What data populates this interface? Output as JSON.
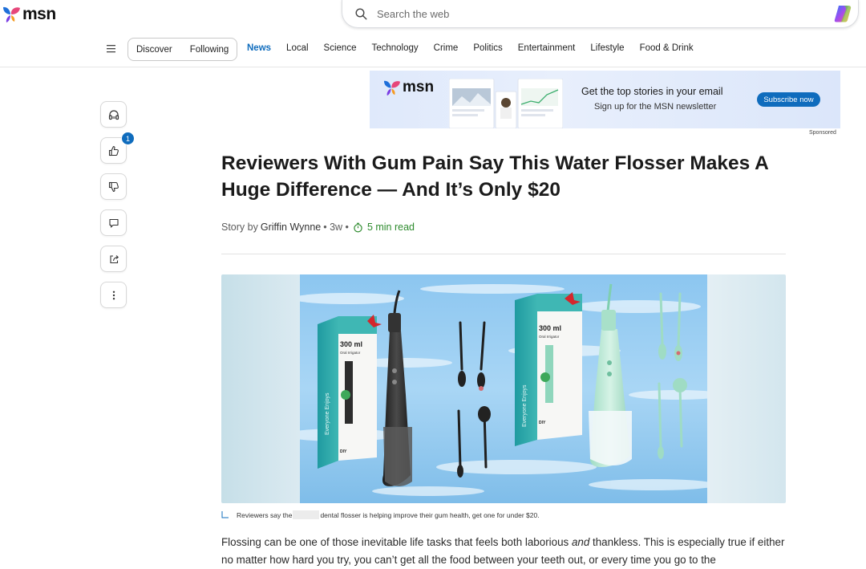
{
  "header": {
    "logo_text": "msn",
    "search_placeholder": "Search the web"
  },
  "nav": {
    "pill": [
      "Discover",
      "Following"
    ],
    "links": [
      {
        "label": "News",
        "active": true
      },
      {
        "label": "Local"
      },
      {
        "label": "Science"
      },
      {
        "label": "Technology"
      },
      {
        "label": "Crime"
      },
      {
        "label": "Politics"
      },
      {
        "label": "Entertainment"
      },
      {
        "label": "Lifestyle"
      },
      {
        "label": "Food & Drink"
      }
    ]
  },
  "rail": {
    "like_count": "1",
    "icons": [
      "headphones-icon",
      "thumbs-up-icon",
      "thumbs-down-icon",
      "comment-icon",
      "share-icon",
      "more-icon"
    ]
  },
  "ad": {
    "logo_text": "msn",
    "title": "Get the top stories in your email",
    "subtitle": "Sign up for the MSN newsletter",
    "button": "Subscribe now",
    "sponsored": "Sponsored"
  },
  "article": {
    "headline": "Reviewers With Gum Pain Say This Water Flosser Makes A Huge Difference — And It’s Only $20",
    "byline_prefix": "Story by",
    "author": "Griffin Wynne",
    "age": "• 3w •",
    "read_time": "5 min read",
    "hero_text": {
      "capacity": "300 ml",
      "product": "Oral Irrigator",
      "brand": "Everyone Enjoys",
      "badge": "DIY"
    },
    "caption_before": "Reviewers say the",
    "caption_after": "dental flosser is helping improve their gum health, get one for under $20.",
    "body_start": "Flossing can be one of those inevitable life tasks that feels both laborious ",
    "body_em": "and",
    "body_end": " thankless. This is especially true if either no matter how hard you try, you can’t get all the food between your teeth out, or every time you go to the"
  },
  "colors": {
    "accent": "#0f6cbd",
    "read_time": "#2e8b2e"
  }
}
